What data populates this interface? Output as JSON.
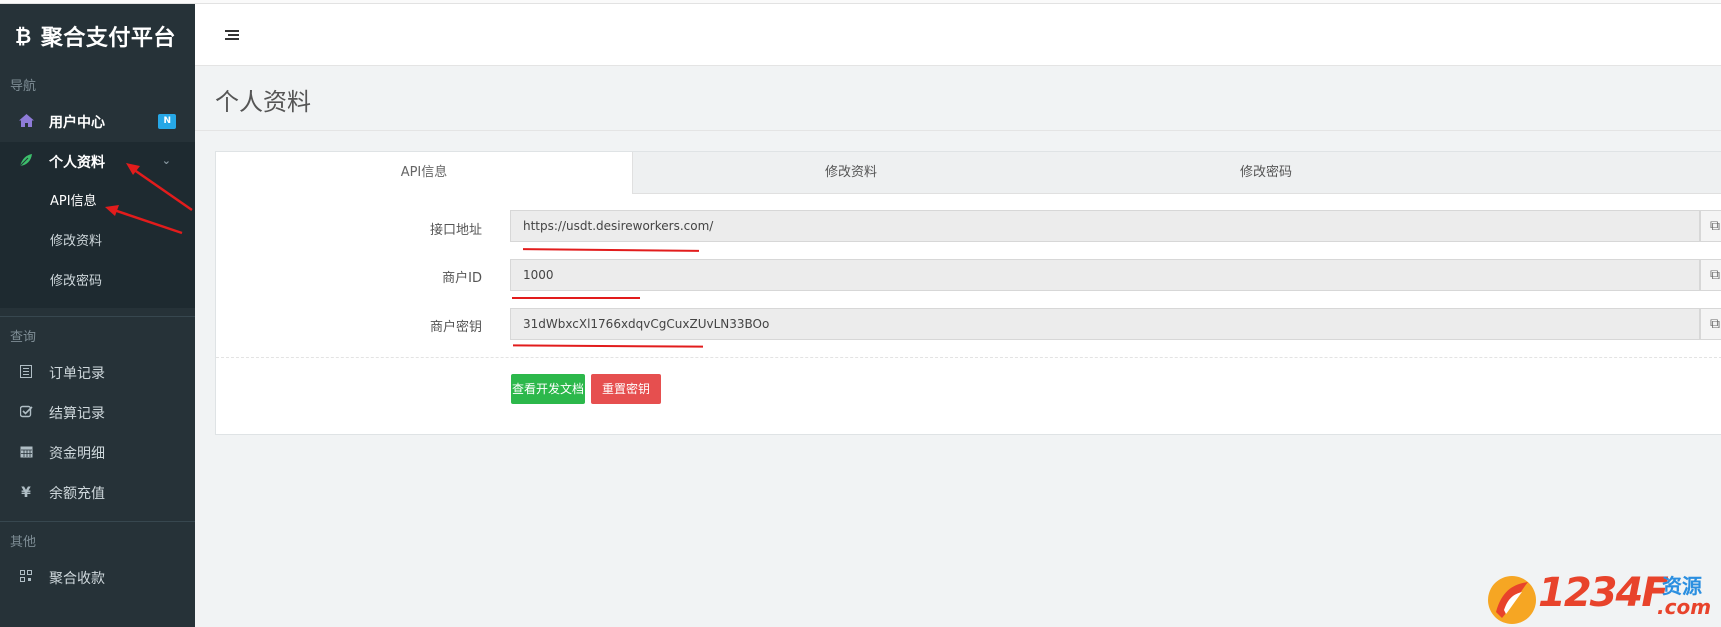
{
  "app": {
    "brand_icon": "₿",
    "brand_name": "聚合支付平台"
  },
  "sidebar": {
    "sections": [
      {
        "header": "导航"
      },
      {
        "header": "查询"
      },
      {
        "header": "其他"
      }
    ],
    "items": [
      {
        "label": "用户中心",
        "icon": "home-icon",
        "badge": "N"
      },
      {
        "label": "个人资料",
        "icon": "leaf-icon"
      },
      {
        "label": "订单记录",
        "icon": "list-icon"
      },
      {
        "label": "结算记录",
        "icon": "check-square-icon"
      },
      {
        "label": "资金明细",
        "icon": "calendar-icon"
      },
      {
        "label": "余额充值",
        "icon": "yen-icon"
      },
      {
        "label": "聚合收款",
        "icon": "qrcode-icon"
      }
    ],
    "sub_items": [
      "API信息",
      "修改资料",
      "修改密码"
    ]
  },
  "page": {
    "title": "个人资料"
  },
  "tabs": [
    "API信息",
    "修改资料",
    "修改密码"
  ],
  "form": {
    "rows": [
      {
        "label": "接口地址",
        "value": "https://usdt.desireworkers.com/"
      },
      {
        "label": "商户ID",
        "value": "1000"
      },
      {
        "label": "商户密钥",
        "value": "31dWbxcXl1766xdqvCgCuxZUvLN33BOo"
      }
    ],
    "buttons": {
      "docs": "查看开发文档",
      "reset": "重置密钥"
    }
  },
  "watermark": {
    "text": "1234F",
    "sub1": "资源",
    "sub2": ".com"
  },
  "colors": {
    "sidebar_bg": "#263238",
    "badge": "#26a7e6",
    "btn_green": "#2cb84b",
    "btn_red": "#e64f4f",
    "annotation_red": "#e21c1c"
  }
}
